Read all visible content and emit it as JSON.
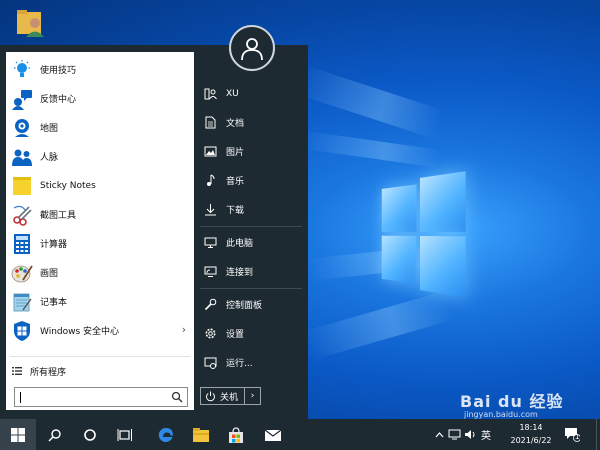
{
  "start_menu": {
    "apps": [
      {
        "label": "使用技巧",
        "icon": "lightbulb-icon"
      },
      {
        "label": "反馈中心",
        "icon": "feedback-hub-icon"
      },
      {
        "label": "地图",
        "icon": "maps-icon"
      },
      {
        "label": "人脉",
        "icon": "people-icon"
      },
      {
        "label": "Sticky Notes",
        "icon": "sticky-notes-icon"
      },
      {
        "label": "截图工具",
        "icon": "snipping-tool-icon"
      },
      {
        "label": "计算器",
        "icon": "calculator-icon"
      },
      {
        "label": "画图",
        "icon": "paint-icon"
      },
      {
        "label": "记事本",
        "icon": "notepad-icon"
      },
      {
        "label": "Windows 安全中心",
        "icon": "windows-security-icon",
        "has_submenu": true
      }
    ],
    "all_programs": "所有程序",
    "search": {
      "value": ""
    },
    "places": [
      {
        "label": "XU",
        "icon": "user-folder-icon"
      },
      {
        "label": "文档",
        "icon": "document-icon"
      },
      {
        "label": "图片",
        "icon": "picture-icon"
      },
      {
        "label": "音乐",
        "icon": "music-icon"
      },
      {
        "label": "下载",
        "icon": "download-icon"
      },
      {
        "label": "此电脑",
        "icon": "computer-icon"
      },
      {
        "label": "连接到",
        "icon": "connect-icon"
      },
      {
        "label": "控制面板",
        "icon": "control-panel-icon"
      },
      {
        "label": "设置",
        "icon": "gear-icon"
      },
      {
        "label": "运行...",
        "icon": "run-icon"
      }
    ],
    "power_label": "关机"
  },
  "taskbar": {
    "ime_label": "英",
    "time": "18:14",
    "date": "2021/6/22",
    "notification_count": "1"
  },
  "watermark": {
    "brand": "Bai du 经验",
    "url": "jingyan.baidu.com"
  },
  "colors": {
    "menu_bg": "#1e2a32",
    "desktop_blue": "#0b5ac8",
    "accent_blue": "#0078d7"
  }
}
